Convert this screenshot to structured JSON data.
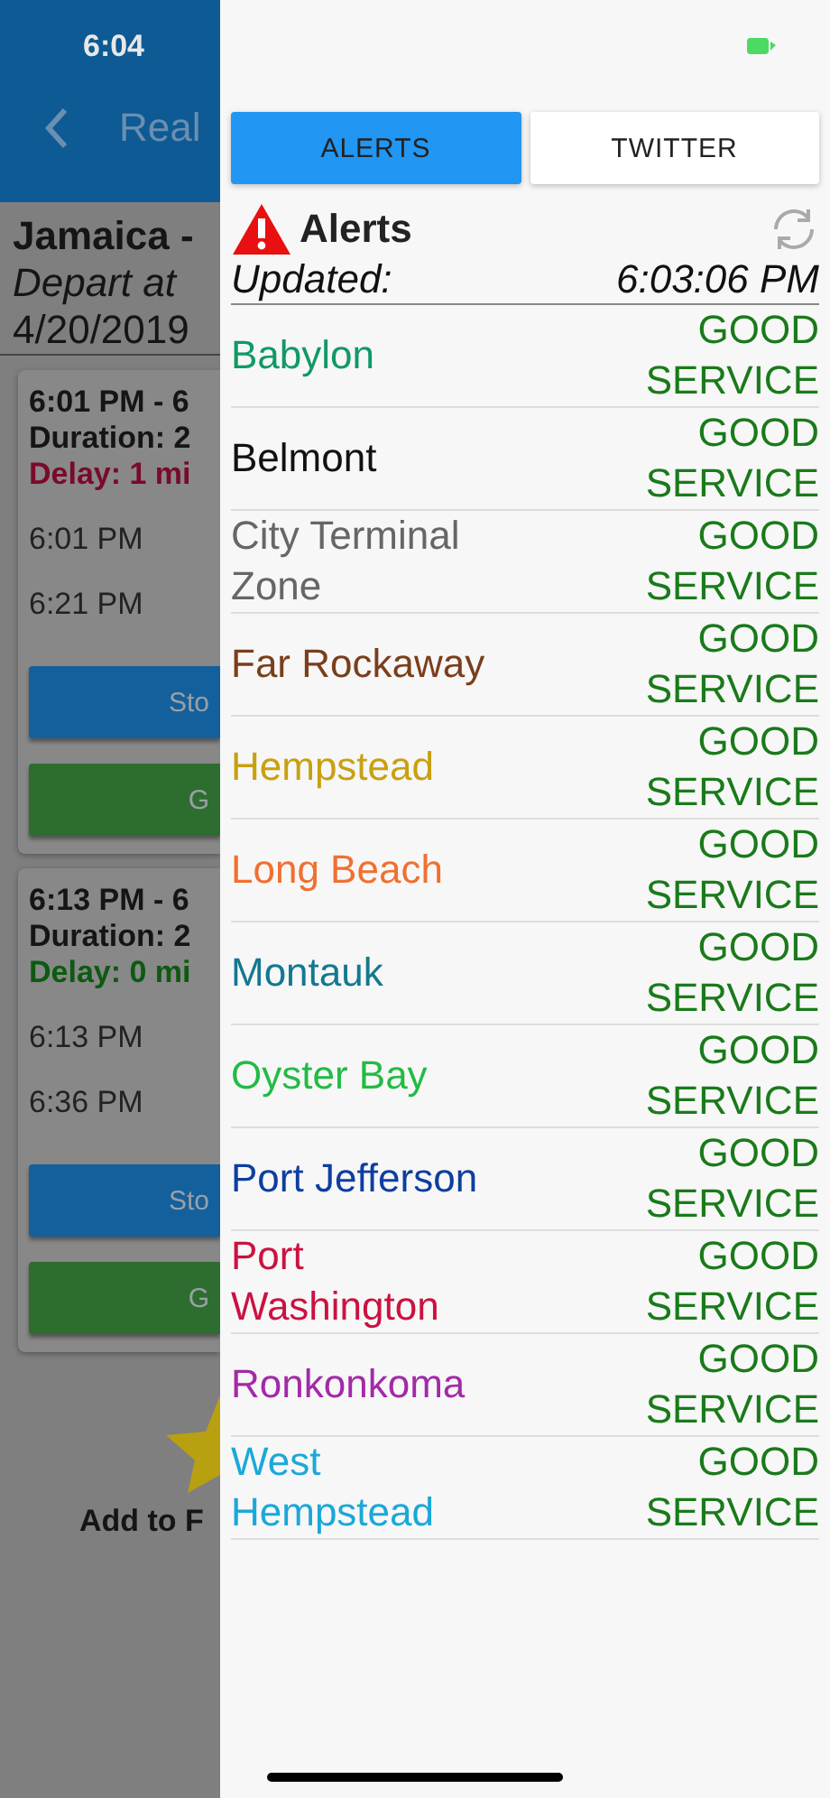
{
  "status_bar": {
    "time": "6:04"
  },
  "background": {
    "header_title": "Real",
    "route": "Jamaica -",
    "depart": "Depart at",
    "date": "4/20/2019",
    "trips": [
      {
        "times": "6:01 PM - 6",
        "duration": "Duration: 2",
        "delay": "Delay: 1 mi",
        "late": true,
        "stops": [
          "6:01 PM",
          "6:21 PM"
        ],
        "buttons": [
          "Sto",
          "G"
        ]
      },
      {
        "times": "6:13 PM - 6",
        "duration": "Duration: 2",
        "delay": "Delay: 0 mi",
        "late": false,
        "stops": [
          "6:13 PM",
          "6:36 PM"
        ],
        "buttons": [
          "Sto",
          "G"
        ]
      }
    ],
    "favorite_label": "Add to F"
  },
  "drawer": {
    "tabs": [
      {
        "label": "ALERTS",
        "selected": true
      },
      {
        "label": "TWITTER",
        "selected": false
      }
    ],
    "title": "Alerts",
    "updated_label": "Updated:",
    "updated_time": "6:03:06 PM",
    "lines": [
      {
        "name": "Babylon",
        "color": "#119966",
        "status": "GOOD SERVICE"
      },
      {
        "name": "Belmont",
        "color": "#111111",
        "status": "GOOD SERVICE"
      },
      {
        "name": "City Terminal Zone",
        "color": "#666666",
        "status": "GOOD SERVICE"
      },
      {
        "name": "Far Rockaway",
        "color": "#7a3e1c",
        "status": "GOOD SERVICE"
      },
      {
        "name": "Hempstead",
        "color": "#c8a010",
        "status": "GOOD SERVICE"
      },
      {
        "name": "Long Beach",
        "color": "#f07030",
        "status": "GOOD SERVICE"
      },
      {
        "name": "Montauk",
        "color": "#137890",
        "status": "GOOD SERVICE"
      },
      {
        "name": "Oyster Bay",
        "color": "#22bb44",
        "status": "GOOD SERVICE"
      },
      {
        "name": "Port Jefferson",
        "color": "#0d3ea0",
        "status": "GOOD SERVICE"
      },
      {
        "name": "Port Washington",
        "color": "#cc1140",
        "status": "GOOD SERVICE"
      },
      {
        "name": "Ronkonkoma",
        "color": "#a22aa8",
        "status": "GOOD SERVICE"
      },
      {
        "name": "West Hempstead",
        "color": "#1aa8d8",
        "status": "GOOD SERVICE"
      }
    ]
  }
}
